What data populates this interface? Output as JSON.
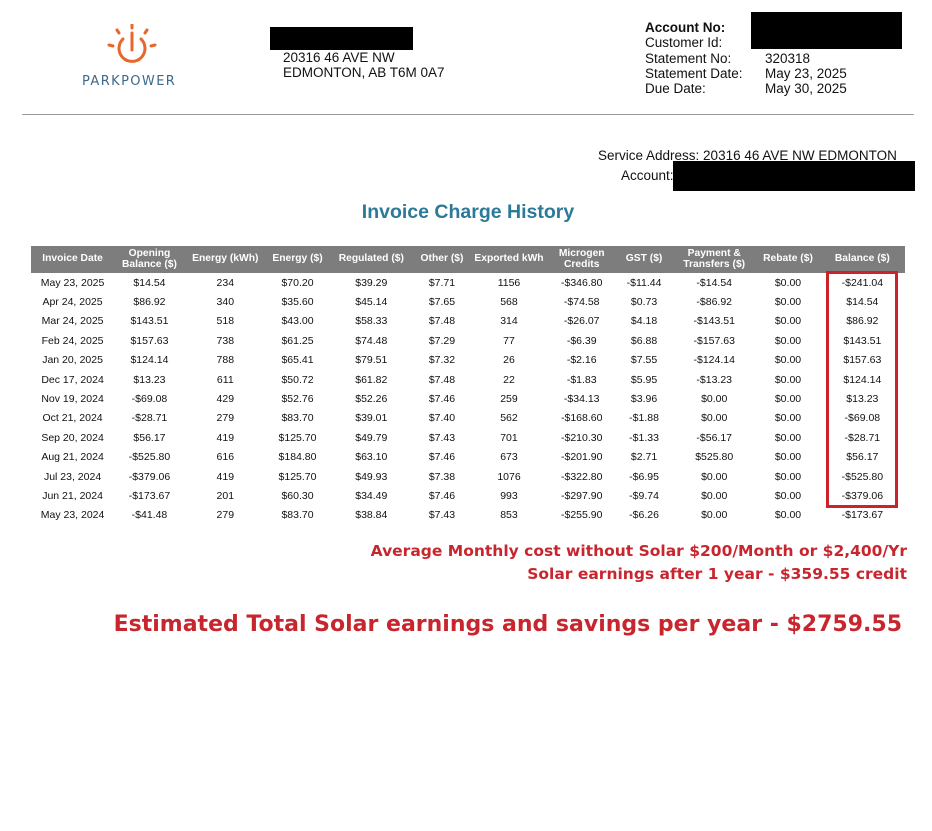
{
  "logo": {
    "text_left": "PARK",
    "text_right": "POWER",
    "icon": "power-button-sun-icon",
    "accent": "#e8662a",
    "brand": "#3d6a8c"
  },
  "address": {
    "line1": "20316 46 AVE NW",
    "line2": "EDMONTON, AB T6M 0A7"
  },
  "account": {
    "rows": [
      {
        "label": "Account No:",
        "value": ""
      },
      {
        "label": "Customer Id:",
        "value": ""
      },
      {
        "label": "Statement No:",
        "value": "320318"
      },
      {
        "label": "Statement Date:",
        "value": "May 23, 2025"
      },
      {
        "label": "Due Date:",
        "value": "May 30, 2025"
      }
    ]
  },
  "service": {
    "address_text": "Service Address: 20316 46 AVE NW EDMONTON",
    "account_label": "Account:"
  },
  "title": "Invoice Charge History",
  "table": {
    "headers": [
      "Invoice Date",
      "Opening Balance ($)",
      "Energy (kWh)",
      "Energy ($)",
      "Regulated ($)",
      "Other ($)",
      "Exported kWh",
      "Microgen Credits",
      "GST ($)",
      "Payment & Transfers ($)",
      "Rebate ($)",
      "Balance ($)"
    ],
    "rows": [
      [
        "May 23, 2025",
        "$14.54",
        "234",
        "$70.20",
        "$39.29",
        "$7.71",
        "1156",
        "-$346.80",
        "-$11.44",
        "-$14.54",
        "$0.00",
        "-$241.04"
      ],
      [
        "Apr 24, 2025",
        "$86.92",
        "340",
        "$35.60",
        "$45.14",
        "$7.65",
        "568",
        "-$74.58",
        "$0.73",
        "-$86.92",
        "$0.00",
        "$14.54"
      ],
      [
        "Mar 24, 2025",
        "$143.51",
        "518",
        "$43.00",
        "$58.33",
        "$7.48",
        "314",
        "-$26.07",
        "$4.18",
        "-$143.51",
        "$0.00",
        "$86.92"
      ],
      [
        "Feb 24, 2025",
        "$157.63",
        "738",
        "$61.25",
        "$74.48",
        "$7.29",
        "77",
        "-$6.39",
        "$6.88",
        "-$157.63",
        "$0.00",
        "$143.51"
      ],
      [
        "Jan 20, 2025",
        "$124.14",
        "788",
        "$65.41",
        "$79.51",
        "$7.32",
        "26",
        "-$2.16",
        "$7.55",
        "-$124.14",
        "$0.00",
        "$157.63"
      ],
      [
        "Dec 17, 2024",
        "$13.23",
        "611",
        "$50.72",
        "$61.82",
        "$7.48",
        "22",
        "-$1.83",
        "$5.95",
        "-$13.23",
        "$0.00",
        "$124.14"
      ],
      [
        "Nov 19, 2024",
        "-$69.08",
        "429",
        "$52.76",
        "$52.26",
        "$7.46",
        "259",
        "-$34.13",
        "$3.96",
        "$0.00",
        "$0.00",
        "$13.23"
      ],
      [
        "Oct 21, 2024",
        "-$28.71",
        "279",
        "$83.70",
        "$39.01",
        "$7.40",
        "562",
        "-$168.60",
        "-$1.88",
        "$0.00",
        "$0.00",
        "-$69.08"
      ],
      [
        "Sep 20, 2024",
        "$56.17",
        "419",
        "$125.70",
        "$49.79",
        "$7.43",
        "701",
        "-$210.30",
        "-$1.33",
        "-$56.17",
        "$0.00",
        "-$28.71"
      ],
      [
        "Aug 21, 2024",
        "-$525.80",
        "616",
        "$184.80",
        "$63.10",
        "$7.46",
        "673",
        "-$201.90",
        "$2.71",
        "$525.80",
        "$0.00",
        "$56.17"
      ],
      [
        "Jul 23, 2024",
        "-$379.06",
        "419",
        "$125.70",
        "$49.93",
        "$7.38",
        "1076",
        "-$322.80",
        "-$6.95",
        "$0.00",
        "$0.00",
        "-$525.80"
      ],
      [
        "Jun 21, 2024",
        "-$173.67",
        "201",
        "$60.30",
        "$34.49",
        "$7.46",
        "993",
        "-$297.90",
        "-$9.74",
        "$0.00",
        "$0.00",
        "-$379.06"
      ],
      [
        "May 23, 2024",
        "-$41.48",
        "279",
        "$83.70",
        "$38.84",
        "$7.43",
        "853",
        "-$255.90",
        "-$6.26",
        "$0.00",
        "$0.00",
        "-$173.67"
      ]
    ]
  },
  "notes": {
    "line1": "Average Monthly cost without Solar $200/Month or $2,400/Yr",
    "line2": "Solar earnings after 1 year - $359.55 credit",
    "line3": "Estimated Total Solar earnings and savings per year - $2759.55",
    "color": "#c8262e"
  }
}
